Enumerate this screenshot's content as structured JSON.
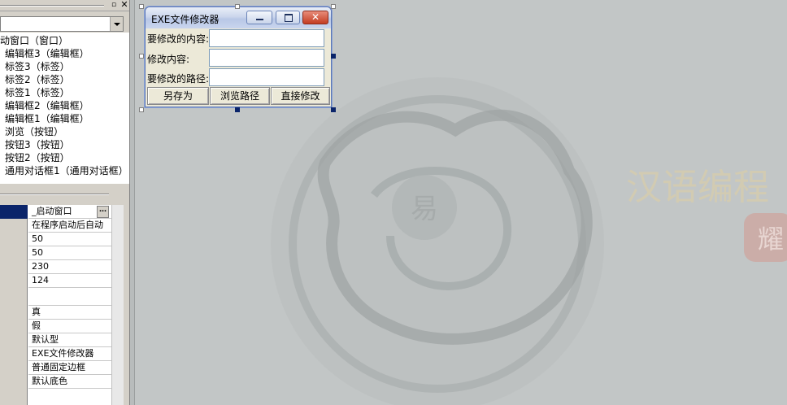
{
  "panel": {
    "restore_glyph": "▫",
    "close_glyph": "✕",
    "tree_items": [
      "启动窗口（窗口）",
      "编辑框3（编辑框）",
      "标签3（标签）",
      "标签2（标签）",
      "标签1（标签）",
      "编辑框2（编辑框）",
      "编辑框1（编辑框）",
      "浏览（按钮）",
      "按钮3（按钮）",
      "按钮2（按钮）",
      "通用对话框1（通用对话框）"
    ],
    "properties": [
      "_启动窗口",
      "在程序启动后自动",
      "50",
      "50",
      "230",
      "124",
      "",
      "真",
      "假",
      "默认型",
      "EXE文件修改器",
      "普通固定边框",
      "默认底色"
    ],
    "ellipsis_label": "…"
  },
  "form": {
    "title": "EXE文件修改器",
    "close_glyph": "✕",
    "labels": [
      "要修改的内容:",
      "修改内容:",
      "要修改的路径:"
    ],
    "buttons": [
      "另存为",
      "浏览路径",
      "直接修改"
    ]
  },
  "watermark": {
    "center_char": "易",
    "brand_text": "汉语编程",
    "seal_text": "耀"
  },
  "colors": {
    "canvas_bg": "#c2c6c6",
    "selection": "#0a246a",
    "form_close": "#c33d22"
  }
}
